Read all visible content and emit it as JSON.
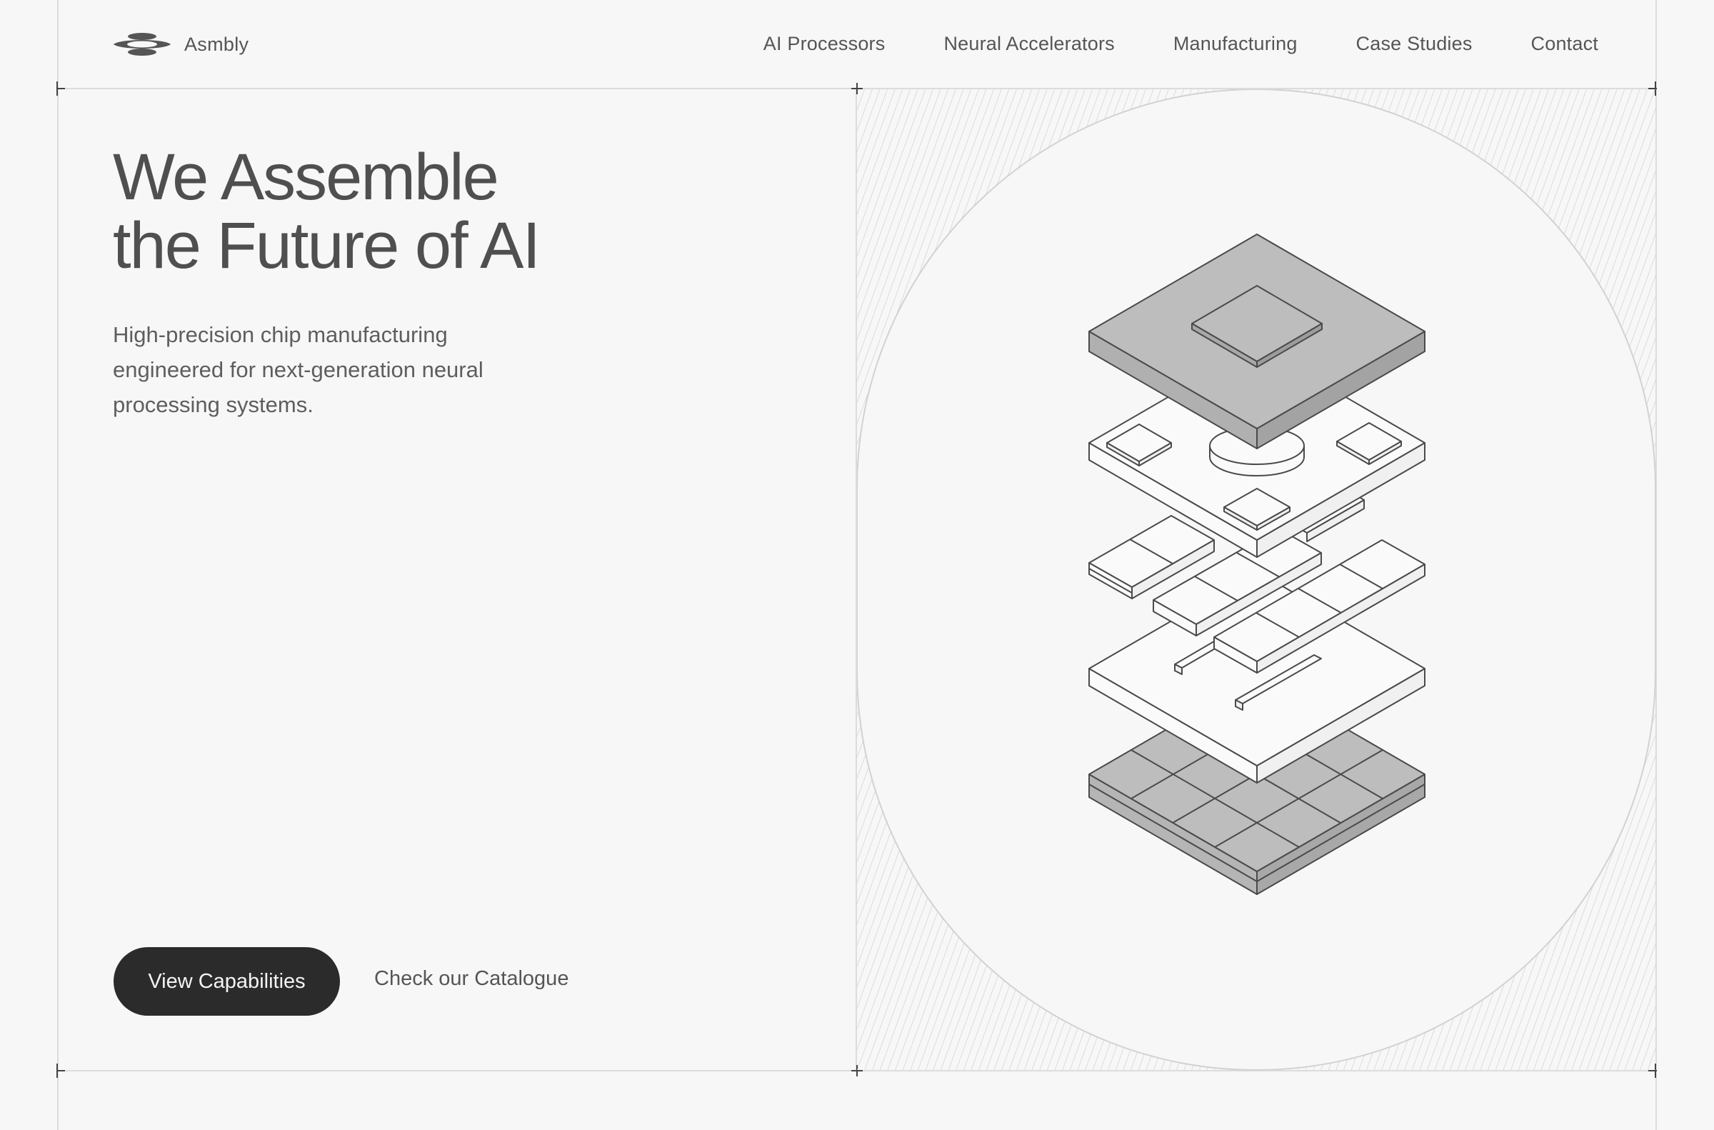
{
  "brand": {
    "name": "Asmbly",
    "logo_icon": "stacked-discs-logo"
  },
  "nav": {
    "items": [
      {
        "label": "AI Processors"
      },
      {
        "label": "Neural Accelerators"
      },
      {
        "label": "Manufacturing"
      },
      {
        "label": "Case Studies"
      },
      {
        "label": "Contact"
      }
    ]
  },
  "hero": {
    "title_line1": "We Assemble",
    "title_line2": "the Future of AI",
    "subtitle_line1": "High-precision chip manufacturing",
    "subtitle_line2": "engineered for next-generation neural",
    "subtitle_line3": "processing systems.",
    "primary_cta": "View Capabilities",
    "secondary_cta": "Check our Catalogue"
  },
  "illustration": {
    "icon": "exploded-chip-stack-illustration"
  },
  "colors": {
    "background": "#f7f7f7",
    "text": "#555555",
    "button": "#2b2b2b",
    "chip_fill": "#bdbdbd",
    "outline": "#4a4a4a"
  }
}
